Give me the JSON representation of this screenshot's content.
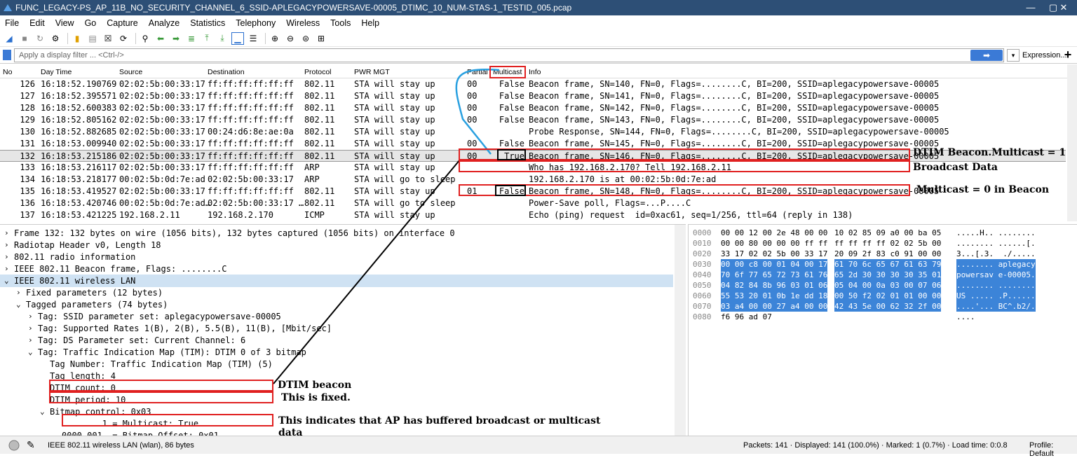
{
  "window": {
    "title": "FUNC_LEGACY-PS_AP_11B_NO_SECURITY_CHANNEL_6_SSID-APLEGACYPOWERSAVE-00005_DTIMC_10_NUM-STAS-1_TESTID_005.pcap",
    "min": "—",
    "max": "▢",
    "close": "✕"
  },
  "menu": [
    "File",
    "Edit",
    "View",
    "Go",
    "Capture",
    "Analyze",
    "Statistics",
    "Telephony",
    "Wireless",
    "Tools",
    "Help"
  ],
  "filter": {
    "placeholder": "Apply a display filter ... <Ctrl-/>",
    "expression": "Expression...",
    "plus": "+",
    "arrow": "➡",
    "dropdown": "▾"
  },
  "columns": {
    "no": "No",
    "time": "Day Time",
    "source": "Source",
    "destination": "Destination",
    "protocol": "Protocol",
    "pwr": "PWR MGT",
    "partial": "Partial",
    "multicast": "Multicast",
    "info": "Info"
  },
  "packets": [
    {
      "no": "126",
      "time": "16:18:52.190769",
      "src": "02:02:5b:00:33:17",
      "dst": "ff:ff:ff:ff:ff:ff",
      "proto": "802.11",
      "pwr": "STA will stay up",
      "partial": "00",
      "mc": "False",
      "info": "Beacon frame, SN=140, FN=0, Flags=........C, BI=200, SSID=aplegacypowersave-00005"
    },
    {
      "no": "127",
      "time": "16:18:52.395571",
      "src": "02:02:5b:00:33:17",
      "dst": "ff:ff:ff:ff:ff:ff",
      "proto": "802.11",
      "pwr": "STA will stay up",
      "partial": "00",
      "mc": "False",
      "info": "Beacon frame, SN=141, FN=0, Flags=........C, BI=200, SSID=aplegacypowersave-00005"
    },
    {
      "no": "128",
      "time": "16:18:52.600383",
      "src": "02:02:5b:00:33:17",
      "dst": "ff:ff:ff:ff:ff:ff",
      "proto": "802.11",
      "pwr": "STA will stay up",
      "partial": "00",
      "mc": "False",
      "info": "Beacon frame, SN=142, FN=0, Flags=........C, BI=200, SSID=aplegacypowersave-00005"
    },
    {
      "no": "129",
      "time": "16:18:52.805162",
      "src": "02:02:5b:00:33:17",
      "dst": "ff:ff:ff:ff:ff:ff",
      "proto": "802.11",
      "pwr": "STA will stay up",
      "partial": "00",
      "mc": "False",
      "info": "Beacon frame, SN=143, FN=0, Flags=........C, BI=200, SSID=aplegacypowersave-00005"
    },
    {
      "no": "130",
      "time": "16:18:52.882685",
      "src": "02:02:5b:00:33:17",
      "dst": "00:24:d6:8e:ae:0a",
      "proto": "802.11",
      "pwr": "STA will stay up",
      "partial": "",
      "mc": "",
      "info": "Probe Response, SN=144, FN=0, Flags=........C, BI=200, SSID=aplegacypowersave-00005"
    },
    {
      "no": "131",
      "time": "16:18:53.009940",
      "src": "02:02:5b:00:33:17",
      "dst": "ff:ff:ff:ff:ff:ff",
      "proto": "802.11",
      "pwr": "STA will stay up",
      "partial": "00",
      "mc": "False",
      "info": "Beacon frame, SN=145, FN=0, Flags=........C, BI=200, SSID=aplegacypowersave-00005"
    },
    {
      "no": "132",
      "time": "16:18:53.215186",
      "src": "02:02:5b:00:33:17",
      "dst": "ff:ff:ff:ff:ff:ff",
      "proto": "802.11",
      "pwr": "STA will stay up",
      "partial": "00",
      "mc": "True",
      "info": "Beacon frame, SN=146, FN=0, Flags=........C, BI=200, SSID=aplegacypowersave-00005"
    },
    {
      "no": "133",
      "time": "16:18:53.216117",
      "src": "02:02:5b:00:33:17",
      "dst": "ff:ff:ff:ff:ff:ff",
      "proto": "ARP",
      "pwr": "STA will stay up",
      "partial": "",
      "mc": "",
      "info": "Who has 192.168.2.170? Tell 192.168.2.11"
    },
    {
      "no": "134",
      "time": "16:18:53.218177",
      "src": "00:02:5b:0d:7e:ad",
      "dst": "02:02:5b:00:33:17",
      "proto": "ARP",
      "pwr": "STA will go to sleep",
      "partial": "",
      "mc": "",
      "info": "192.168.2.170 is at 00:02:5b:0d:7e:ad"
    },
    {
      "no": "135",
      "time": "16:18:53.419527",
      "src": "02:02:5b:00:33:17",
      "dst": "ff:ff:ff:ff:ff:ff",
      "proto": "802.11",
      "pwr": "STA will stay up",
      "partial": "01",
      "mc": "False",
      "info": "Beacon frame, SN=148, FN=0, Flags=........C, BI=200, SSID=aplegacypowersave-00005"
    },
    {
      "no": "136",
      "time": "16:18:53.420746",
      "src": "00:02:5b:0d:7e:ad…",
      "dst": "02:02:5b:00:33:17 …",
      "proto": "802.11",
      "pwr": "STA will go to sleep",
      "partial": "",
      "mc": "",
      "info": "Power-Save poll, Flags=...P....C"
    },
    {
      "no": "137",
      "time": "16:18:53.421225",
      "src": "192.168.2.11",
      "dst": "192.168.2.170",
      "proto": "ICMP",
      "pwr": "STA will stay up",
      "partial": "",
      "mc": "",
      "info": "Echo (ping) request  id=0xac61, seq=1/256, ttl=64 (reply in 138)"
    }
  ],
  "detail": [
    {
      "ar": "›",
      "t": "Frame 132: 132 bytes on wire (1056 bits), 132 bytes captured (1056 bits) on interface 0",
      "lvl": 0
    },
    {
      "ar": "›",
      "t": "Radiotap Header v0, Length 18",
      "lvl": 0
    },
    {
      "ar": "›",
      "t": "802.11 radio information",
      "lvl": 0
    },
    {
      "ar": "›",
      "t": "IEEE 802.11 Beacon frame, Flags: ........C",
      "lvl": 0
    },
    {
      "ar": "⌄",
      "t": "IEEE 802.11 wireless LAN",
      "lvl": 0,
      "sel": true
    },
    {
      "ar": "›",
      "t": "Fixed parameters (12 bytes)",
      "lvl": 1
    },
    {
      "ar": "⌄",
      "t": "Tagged parameters (74 bytes)",
      "lvl": 1
    },
    {
      "ar": "›",
      "t": "Tag: SSID parameter set: aplegacypowersave-00005",
      "lvl": 2
    },
    {
      "ar": "›",
      "t": "Tag: Supported Rates 1(B), 2(B), 5.5(B), 11(B), [Mbit/sec]",
      "lvl": 2
    },
    {
      "ar": "›",
      "t": "Tag: DS Parameter set: Current Channel: 6",
      "lvl": 2
    },
    {
      "ar": "⌄",
      "t": "Tag: Traffic Indication Map (TIM): DTIM 0 of 3 bitmap",
      "lvl": 2
    },
    {
      "ar": "",
      "t": "Tag Number: Traffic Indication Map (TIM) (5)",
      "lvl": 3
    },
    {
      "ar": "",
      "t": "Tag length: 4",
      "lvl": 3
    },
    {
      "ar": "",
      "t": "DTIM count: 0",
      "lvl": 3
    },
    {
      "ar": "",
      "t": "DTIM period: 10",
      "lvl": 3
    },
    {
      "ar": "⌄",
      "t": "Bitmap control: 0x03",
      "lvl": 3
    },
    {
      "ar": "",
      "t": ".... ...1 = Multicast: True",
      "lvl": 4
    },
    {
      "ar": "",
      "t": "0000 001. = Bitmap Offset: 0x01",
      "lvl": 4
    }
  ],
  "hex": [
    {
      "off": "0000",
      "a": "00 00 12 00 2e 48 00 00",
      "b": "10 02 85 09 a0 00 ba 05",
      "asc": ".....H.. ........"
    },
    {
      "off": "0010",
      "a": "00 00 80 00 00 00 ff ff",
      "b": "ff ff ff ff 02 02 5b 00",
      "asc": "........ ......[."
    },
    {
      "off": "0020",
      "a": "33 17 02 02 5b 00 33 17",
      "b": "20 09 2f 83 c0 91 00 00",
      "asc": "3...[.3.  ./....."
    },
    {
      "off": "0030",
      "a": "00 00 c8 00 01 04 00 17",
      "b": "61 70 6c 65 67 61 63 79",
      "asc": "........ aplegacy"
    },
    {
      "off": "0040",
      "a": "70 6f 77 65 72 73 61 76",
      "b": "65 2d 30 30 30 30 35 01",
      "asc": "powersav e-00005."
    },
    {
      "off": "0050",
      "a": "04 82 84 8b 96 03 01 06",
      "b": "05 04 00 0a 03 00 07 06",
      "asc": "........ ........"
    },
    {
      "off": "0060",
      "a": "55 53 20 01 0b 1e dd 18",
      "b": "00 50 f2 02 01 01 00 00",
      "asc": "US ..... .P......"
    },
    {
      "off": "0070",
      "a": "03 a4 00 00 27 a4 00 00",
      "b": "42 43 5e 00 62 32 2f 00",
      "asc": "....'... BC^.b2/."
    },
    {
      "off": "0080",
      "a": "f6 96 ad 07",
      "b": "",
      "asc": "...."
    }
  ],
  "status": {
    "left": "IEEE 802.11 wireless LAN (wlan), 86 bytes",
    "packets": "Packets: 141 · Displayed: 141 (100.0%) · Marked: 1 (0.7%) · Load time: 0:0.8",
    "profile": "Profile: Default"
  },
  "annotations": {
    "dtim_beacon_multicast": "DTIM Beacon.Multicast = 1",
    "broadcast_data": "Broadcast Data",
    "multicast_zero": "Multicast = 0 in Beacon",
    "dtim_beacon": "DTIM beacon",
    "fixed": "This is fixed.",
    "buffered_1": "This indicates that AP has buffered broadcast or multicast",
    "buffered_2": "data"
  },
  "colors": {
    "annotation_red": "#e02020",
    "title_bar": "#2d4f76",
    "hex_highlight": "#3c84d8",
    "selection": "#cfe2f3"
  }
}
